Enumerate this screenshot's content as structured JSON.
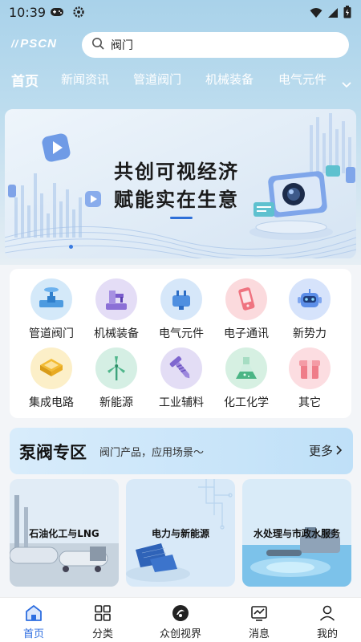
{
  "status_bar": {
    "time": "10:39"
  },
  "header": {
    "logo_text": "PSCN",
    "search_value": "阀门"
  },
  "nav_tabs": [
    {
      "label": "首页",
      "active": true
    },
    {
      "label": "新闻资讯"
    },
    {
      "label": "管道阀门"
    },
    {
      "label": "机械装备"
    },
    {
      "label": "电气元件"
    }
  ],
  "banner": {
    "line1": "共创可视经济",
    "line2": "赋能实在生意"
  },
  "categories": [
    {
      "label": "管道阀门",
      "icon": "valve-icon",
      "color": "#6fb6ec"
    },
    {
      "label": "机械装备",
      "icon": "machine-icon",
      "color": "#a98fe0"
    },
    {
      "label": "电气元件",
      "icon": "plug-icon",
      "color": "#7fb2ea"
    },
    {
      "label": "电子通讯",
      "icon": "phone-icon",
      "color": "#f28b96"
    },
    {
      "label": "新势力",
      "icon": "robot-icon",
      "color": "#7fa6ef"
    },
    {
      "label": "集成电路",
      "icon": "chip-icon",
      "color": "#f5c75a"
    },
    {
      "label": "新能源",
      "icon": "wind-turbine-icon",
      "color": "#5bbf98"
    },
    {
      "label": "工业辅料",
      "icon": "screw-icon",
      "color": "#9d8ad8"
    },
    {
      "label": "化工化学",
      "icon": "flask-icon",
      "color": "#69c39a"
    },
    {
      "label": "其它",
      "icon": "box-icon",
      "color": "#f39aa4"
    }
  ],
  "zone": {
    "title": "泵阀专区",
    "subtitle": "阀门产品，应用场景～",
    "more_label": "更多"
  },
  "solutions": [
    {
      "label": "石油化工与LNG"
    },
    {
      "label": "电力与新能源"
    },
    {
      "label": "水处理与市政水服务"
    }
  ],
  "bottom_nav": [
    {
      "label": "首页",
      "icon": "home-icon",
      "active": true
    },
    {
      "label": "分类",
      "icon": "grid-icon"
    },
    {
      "label": "众创视界",
      "icon": "vision-icon"
    },
    {
      "label": "消息",
      "icon": "message-icon"
    },
    {
      "label": "我的",
      "icon": "user-icon"
    }
  ],
  "colors": {
    "accent": "#2e6ee0",
    "top_gradient": "#a9d2ea"
  }
}
